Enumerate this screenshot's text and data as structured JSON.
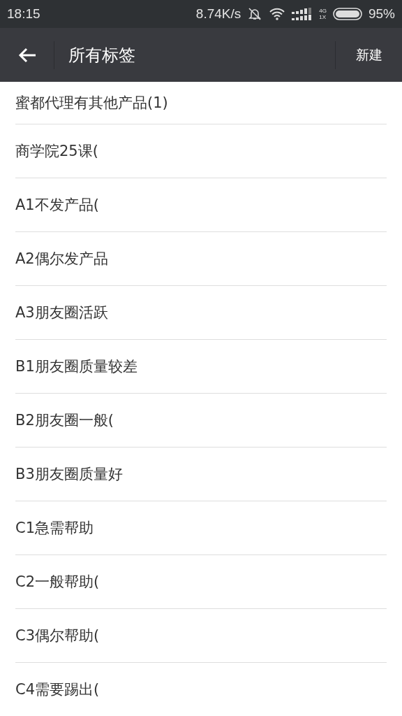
{
  "status_bar": {
    "time": "18:15",
    "speed": "8.74K/s",
    "network_top": "4G",
    "network_bottom": "1X",
    "battery": "95%"
  },
  "header": {
    "title": "所有标签",
    "action": "新建"
  },
  "tags": [
    {
      "label": "蜜都代理有其他产品(1)"
    },
    {
      "label": "商学院25课("
    },
    {
      "label": "A1不发产品("
    },
    {
      "label": "A2偶尔发产品"
    },
    {
      "label": "A3朋友圈活跃"
    },
    {
      "label": "B1朋友圈质量较差"
    },
    {
      "label": "B2朋友圈一般("
    },
    {
      "label": "B3朋友圈质量好"
    },
    {
      "label": "C1急需帮助"
    },
    {
      "label": "C2一般帮助("
    },
    {
      "label": "C3偶尔帮助("
    },
    {
      "label": "C4需要踢出("
    }
  ]
}
